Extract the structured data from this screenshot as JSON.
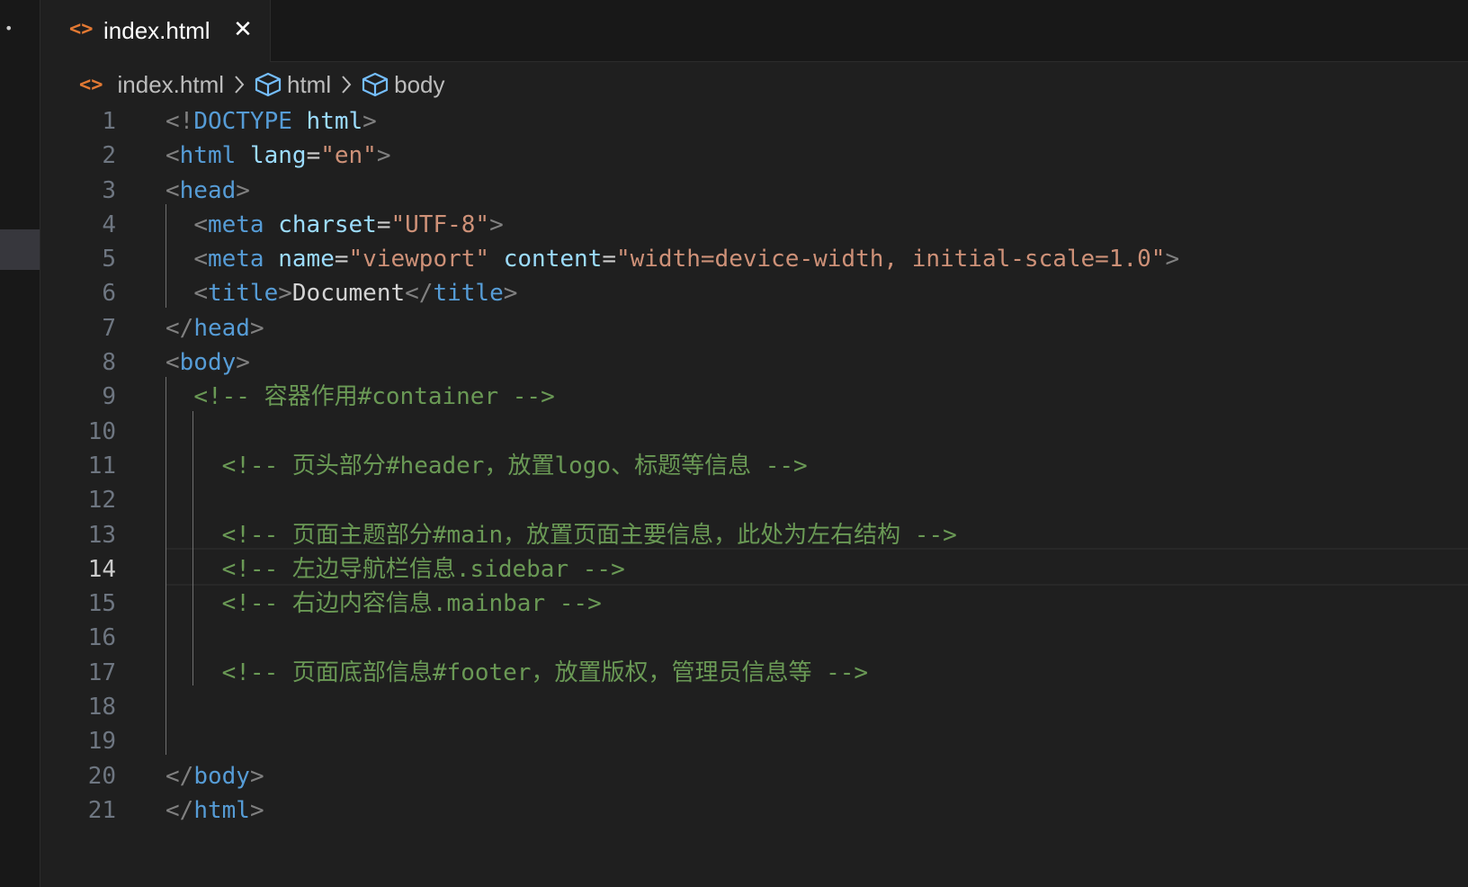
{
  "colors": {
    "background": "#1f1f1f",
    "tab_bar": "#181818",
    "html_icon": "#e37933",
    "tag": "#569cd6",
    "attribute": "#9cdcfe",
    "string": "#ce9178",
    "comment": "#6a9955",
    "punctuation": "#808080",
    "line_number": "#6e7681"
  },
  "icons": {
    "activity": "dot-icon",
    "file": "html-file-icon",
    "close": "close-icon",
    "chevron": "chevron-right-icon",
    "symbol": "cube-icon"
  },
  "tab": {
    "label": "index.html",
    "close_glyph": "✕"
  },
  "breadcrumb": {
    "file": "index.html",
    "items": [
      "html",
      "body"
    ]
  },
  "editor": {
    "active_line": 14,
    "lines": [
      {
        "n": "1",
        "tokens": [
          [
            "tk-punct",
            "<!"
          ],
          [
            "tk-tag",
            "DOCTYPE"
          ],
          [
            "tk-text",
            " "
          ],
          [
            "tk-attr",
            "html"
          ],
          [
            "tk-punct",
            ">"
          ]
        ]
      },
      {
        "n": "2",
        "tokens": [
          [
            "tk-punct",
            "<"
          ],
          [
            "tk-tag",
            "html"
          ],
          [
            "tk-text",
            " "
          ],
          [
            "tk-attr",
            "lang"
          ],
          [
            "tk-eq",
            "="
          ],
          [
            "tk-str",
            "\"en\""
          ],
          [
            "tk-punct",
            ">"
          ]
        ]
      },
      {
        "n": "3",
        "tokens": [
          [
            "tk-punct",
            "<"
          ],
          [
            "tk-tag",
            "head"
          ],
          [
            "tk-punct",
            ">"
          ]
        ]
      },
      {
        "n": "4",
        "tokens": [
          [
            "tk-text",
            "  "
          ],
          [
            "tk-punct",
            "<"
          ],
          [
            "tk-tag",
            "meta"
          ],
          [
            "tk-text",
            " "
          ],
          [
            "tk-attr",
            "charset"
          ],
          [
            "tk-eq",
            "="
          ],
          [
            "tk-str",
            "\"UTF-8\""
          ],
          [
            "tk-punct",
            ">"
          ]
        ]
      },
      {
        "n": "5",
        "tokens": [
          [
            "tk-text",
            "  "
          ],
          [
            "tk-punct",
            "<"
          ],
          [
            "tk-tag",
            "meta"
          ],
          [
            "tk-text",
            " "
          ],
          [
            "tk-attr",
            "name"
          ],
          [
            "tk-eq",
            "="
          ],
          [
            "tk-str",
            "\"viewport\""
          ],
          [
            "tk-text",
            " "
          ],
          [
            "tk-attr",
            "content"
          ],
          [
            "tk-eq",
            "="
          ],
          [
            "tk-str",
            "\"width=device-width, initial-scale=1.0\""
          ],
          [
            "tk-punct",
            ">"
          ]
        ]
      },
      {
        "n": "6",
        "tokens": [
          [
            "tk-text",
            "  "
          ],
          [
            "tk-punct",
            "<"
          ],
          [
            "tk-tag",
            "title"
          ],
          [
            "tk-punct",
            ">"
          ],
          [
            "tk-text",
            "Document"
          ],
          [
            "tk-punct",
            "</"
          ],
          [
            "tk-tag",
            "title"
          ],
          [
            "tk-punct",
            ">"
          ]
        ]
      },
      {
        "n": "7",
        "tokens": [
          [
            "tk-punct",
            "</"
          ],
          [
            "tk-tag",
            "head"
          ],
          [
            "tk-punct",
            ">"
          ]
        ]
      },
      {
        "n": "8",
        "tokens": [
          [
            "tk-punct",
            "<"
          ],
          [
            "tk-tag",
            "body"
          ],
          [
            "tk-punct",
            ">"
          ]
        ]
      },
      {
        "n": "9",
        "tokens": [
          [
            "tk-text",
            "  "
          ],
          [
            "tk-comment",
            "<!-- 容器作用#container -->"
          ]
        ]
      },
      {
        "n": "10",
        "tokens": []
      },
      {
        "n": "11",
        "tokens": [
          [
            "tk-text",
            "    "
          ],
          [
            "tk-comment",
            "<!-- 页头部分#header，放置logo、标题等信息 -->"
          ]
        ]
      },
      {
        "n": "12",
        "tokens": []
      },
      {
        "n": "13",
        "tokens": [
          [
            "tk-text",
            "    "
          ],
          [
            "tk-comment",
            "<!-- 页面主题部分#main，放置页面主要信息，此处为左右结构 -->"
          ]
        ]
      },
      {
        "n": "14",
        "tokens": [
          [
            "tk-text",
            "    "
          ],
          [
            "tk-comment",
            "<!-- 左边导航栏信息.sidebar -->"
          ]
        ]
      },
      {
        "n": "15",
        "tokens": [
          [
            "tk-text",
            "    "
          ],
          [
            "tk-comment",
            "<!-- 右边内容信息.mainbar -->"
          ]
        ]
      },
      {
        "n": "16",
        "tokens": []
      },
      {
        "n": "17",
        "tokens": [
          [
            "tk-text",
            "    "
          ],
          [
            "tk-comment",
            "<!-- 页面底部信息#footer，放置版权，管理员信息等 -->"
          ]
        ]
      },
      {
        "n": "18",
        "tokens": []
      },
      {
        "n": "19",
        "tokens": []
      },
      {
        "n": "20",
        "tokens": [
          [
            "tk-punct",
            "</"
          ],
          [
            "tk-tag",
            "body"
          ],
          [
            "tk-punct",
            ">"
          ]
        ]
      },
      {
        "n": "21",
        "tokens": [
          [
            "tk-punct",
            "</"
          ],
          [
            "tk-tag",
            "html"
          ],
          [
            "tk-punct",
            ">"
          ]
        ]
      }
    ]
  }
}
